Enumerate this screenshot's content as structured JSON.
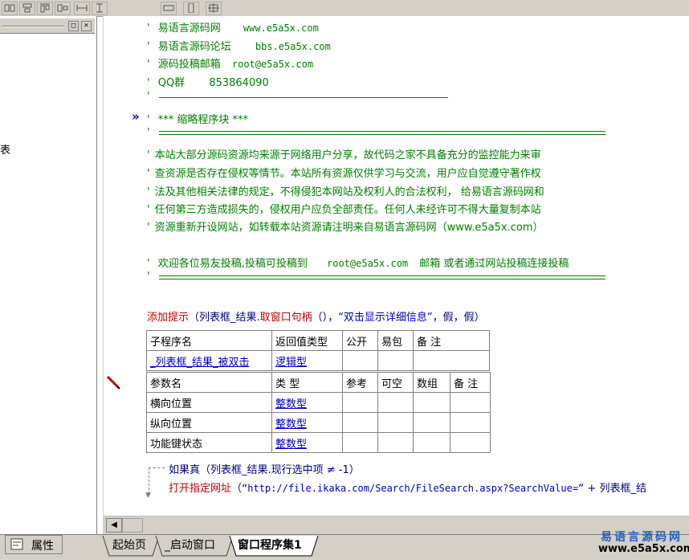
{
  "toolbar": {
    "icons": [
      "align-left-icon",
      "align-center-icon",
      "align-top-icon",
      "align-middle-icon",
      "same-width-icon",
      "same-height-icon",
      "same-size-horizontal-icon",
      "same-size-vertical-icon",
      "same-size-icon"
    ]
  },
  "left_panel": {
    "restore_label": "□",
    "close_label": "×",
    "partial_text": "表"
  },
  "code": {
    "comment_lines": [
      {
        "cn": "易语言源码网",
        "en": "www.e5a5x.com"
      },
      {
        "cn": "易语言源码论坛",
        "en": "bbs.e5a5x.com"
      },
      {
        "cn": "源码投稿邮箱",
        "en": "root@e5a5x.com"
      },
      {
        "cn": "QQ群",
        "en": "853864090"
      }
    ],
    "comment_mark": "'",
    "block_marker": "»",
    "block_title": "*** 缩略程序块 ***",
    "notice": [
      "本站大部分源码资源均来源于网络用户分享，故代码之家不具备充分的监控能力来审",
      "查资源是否存在侵权等情节。本站所有资源仅供学习与交流，用户应自觉遵守著作权",
      "法及其他相关法律的规定，不得侵犯本网站及权利人的合法权利， 给易语言源码网和",
      "任何第三方造成损失的，侵权用户应负全部责任。任何人未经许可不得大量复制本站",
      "资源重新开设网站，如转载本站资源请注明来自易语言源码网（www.e5a5x.com）"
    ],
    "welcome": {
      "pre": "欢迎各位易友投稿,投稿可投稿到",
      "email": "root@e5a5x.com",
      "post": "邮箱 或者通过网站投稿连接投稿"
    },
    "statement": {
      "func": "添加提示",
      "open": "（列表框_结果.",
      "method": "取窗口句柄",
      "args": "（），",
      "text": "“双击显示详细信息”",
      "rest": "，假，假）"
    },
    "sub_table": {
      "headers": [
        "子程序名",
        "返回值类型",
        "公开",
        "易包",
        "备 注"
      ],
      "row": [
        "_列表框_结果_被双击",
        "逻辑型",
        "",
        "",
        ""
      ]
    },
    "param_table": {
      "headers": [
        "参数名",
        "类 型",
        "参考",
        "可空",
        "数组",
        "备 注"
      ],
      "rows": [
        [
          "横向位置",
          "整数型",
          "",
          "",
          "",
          ""
        ],
        [
          "纵向位置",
          "整数型",
          "",
          "",
          "",
          ""
        ],
        [
          "功能键状态",
          "整数型",
          "",
          "",
          "",
          ""
        ]
      ]
    },
    "if_line": {
      "kw": "如果真",
      "cond": "（列表框_结果.现行选中项 ≠ -1）"
    },
    "open_line": {
      "cmd": "打开指定网址",
      "open": "（",
      "url": "“http://file.ikaka.com/Search/FileSearch.aspx?SearchValue=”",
      "rest": " + 列表框_结"
    }
  },
  "bottom": {
    "prop_label": "属性",
    "tabs": [
      "起始页",
      "_启动窗口",
      "窗口程序集1"
    ],
    "active_tab": 2
  },
  "watermark": {
    "line1": "易语言源码网",
    "line2": "www.e5a5x.com"
  }
}
